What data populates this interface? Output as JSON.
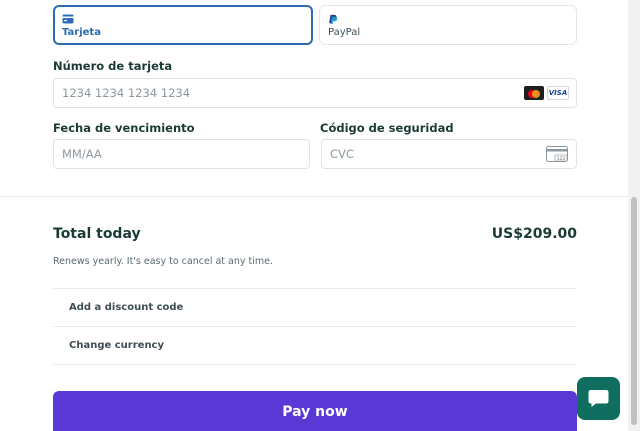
{
  "payment_tabs": [
    {
      "label": "Tarjeta",
      "icon": "credit-card-icon",
      "selected": true
    },
    {
      "label": "PayPal",
      "icon": "paypal-icon",
      "selected": false
    }
  ],
  "card_form": {
    "card_number_label": "Número de tarjeta",
    "card_number_placeholder": "1234 1234 1234 1234",
    "card_brands": [
      "mastercard-icon",
      "VISA"
    ],
    "expiry_label": "Fecha de vencimiento",
    "expiry_placeholder": "MM/AA",
    "cvc_label": "Código de seguridad",
    "cvc_placeholder": "CVC",
    "cvc_icon_text": "123"
  },
  "summary": {
    "total_label": "Total today",
    "total_amount": "US$209.00",
    "renew_note": "Renews yearly. It's easy to cancel at any time."
  },
  "options": {
    "discount_label": "Add a discount code",
    "currency_label": "Change currency"
  },
  "pay_button_label": "Pay now",
  "colors": {
    "accent": "#5a38d6",
    "selected_tab": "#2b6cb0",
    "chat_button": "#0f6e5f",
    "text_dark": "#1b3a35"
  }
}
